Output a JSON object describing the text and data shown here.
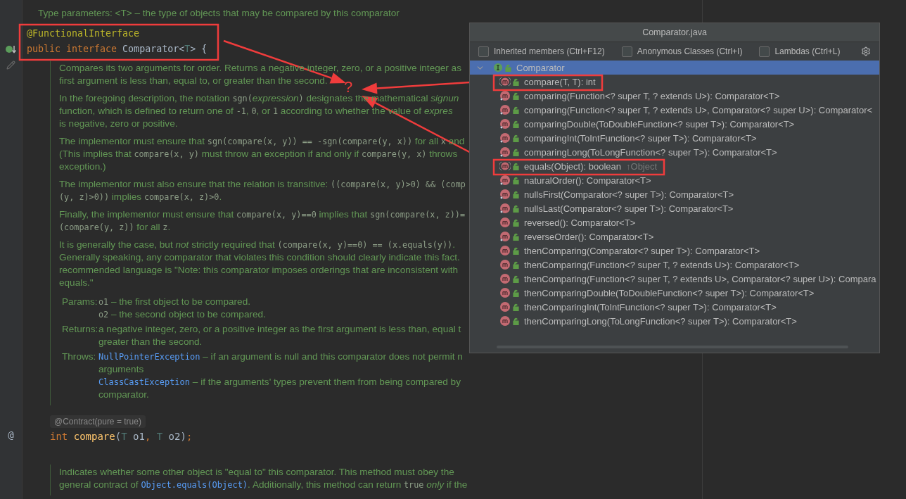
{
  "editor": {
    "type_params": "Type parameters: <T> – the type of objects that may be compared by this comparator",
    "declaration": [
      [
        {
          "kind": "annotation",
          "text": "@FunctionalInterface"
        }
      ],
      [
        {
          "kind": "keyword",
          "text": "public "
        },
        {
          "kind": "keyword",
          "text": "interface "
        },
        {
          "kind": "class",
          "text": "Comparator"
        },
        {
          "kind": "plain",
          "text": "<"
        },
        {
          "kind": "typeparam",
          "text": "T"
        },
        {
          "kind": "plain",
          "text": "> {"
        }
      ]
    ],
    "doc": [
      [
        [
          "Compares its two arguments for order. Returns a negative integer, zero, or a positive integer as"
        ],
        [
          "first argument is less than, equal to, or greater than the second."
        ]
      ],
      [
        [
          "In the foregoing description, the notation ",
          {
            "kind": "code",
            "text": "sgn("
          },
          {
            "kind": "italic",
            "text": "expression"
          },
          {
            "kind": "code",
            "text": ")"
          },
          " designates the mathematical ",
          {
            "kind": "italic",
            "text": "signun"
          }
        ],
        [
          "function, which is defined to return one of ",
          {
            "kind": "code",
            "text": "-1"
          },
          ", ",
          {
            "kind": "code",
            "text": "0"
          },
          ", or ",
          {
            "kind": "code",
            "text": "1"
          },
          " according to whether the value of ",
          {
            "kind": "italic",
            "text": "expres"
          }
        ],
        [
          "is negative, zero or positive."
        ]
      ],
      [
        [
          "The implementor must ensure that ",
          {
            "kind": "code",
            "text": "sgn(compare(x, y)) == -sgn(compare(y, x))"
          },
          " for all ",
          {
            "kind": "code",
            "text": "x"
          },
          " and"
        ],
        [
          "(This implies that ",
          {
            "kind": "code",
            "text": "compare(x, y)"
          },
          " must throw an exception if and only if ",
          {
            "kind": "code",
            "text": "compare(y, x)"
          },
          " throws"
        ],
        [
          "exception.)"
        ]
      ],
      [
        [
          "The implementor must also ensure that the relation is transitive: ",
          {
            "kind": "code",
            "text": "((compare(x, y)>0) && (comp"
          }
        ],
        [
          {
            "kind": "code",
            "text": "(y, z)>0))"
          },
          " implies ",
          {
            "kind": "code",
            "text": "compare(x, z)>0"
          },
          "."
        ]
      ],
      [
        [
          "Finally, the implementor must ensure that ",
          {
            "kind": "code",
            "text": "compare(x, y)==0"
          },
          " implies that ",
          {
            "kind": "code",
            "text": "sgn(compare(x, z))="
          }
        ],
        [
          {
            "kind": "code",
            "text": "(compare(y, z))"
          },
          " for all ",
          {
            "kind": "code",
            "text": "z"
          },
          "."
        ]
      ],
      [
        [
          "It is generally the case, but ",
          {
            "kind": "italic",
            "text": "not"
          },
          " strictly required that ",
          {
            "kind": "code",
            "text": "(compare(x, y)==0) == (x.equals(y))"
          },
          "."
        ],
        [
          "Generally speaking, any comparator that violates this condition should clearly indicate this fact."
        ],
        [
          "recommended language is \"Note: this comparator imposes orderings that are inconsistent with"
        ],
        [
          "equals.\""
        ]
      ]
    ],
    "tags": [
      {
        "label": "Params:",
        "lines": [
          [
            {
              "kind": "code",
              "text": "o1"
            },
            " – the first object to be compared."
          ],
          [
            {
              "kind": "code",
              "text": "o2"
            },
            " – the second object to be compared."
          ]
        ]
      },
      {
        "label": "Returns:",
        "lines": [
          [
            "a negative integer, zero, or a positive integer as the first argument is less than, equal t"
          ],
          [
            "greater than the second."
          ]
        ]
      },
      {
        "label": "Throws:",
        "lines": [
          [
            {
              "kind": "link",
              "text": "NullPointerException"
            },
            " – if an argument is null and this comparator does not permit n"
          ],
          [
            "arguments"
          ],
          [
            {
              "kind": "link",
              "text": "ClassCastException"
            },
            " – if the arguments' types prevent them from being compared by"
          ],
          [
            "comparator."
          ]
        ]
      }
    ],
    "contract": "@Contract(pure = true)",
    "gutter_mark": "@",
    "signature": [
      {
        "kind": "keyword",
        "text": "int "
      },
      {
        "kind": "method",
        "text": "compare"
      },
      {
        "kind": "plain",
        "text": "("
      },
      {
        "kind": "typeparam",
        "text": "T "
      },
      {
        "kind": "plain",
        "text": "o1"
      },
      {
        "kind": "keyword",
        "text": ", "
      },
      {
        "kind": "typeparam",
        "text": "T "
      },
      {
        "kind": "plain",
        "text": "o2"
      },
      {
        "kind": "plain",
        "text": ")"
      },
      {
        "kind": "keyword",
        "text": ";"
      }
    ],
    "doc2": [
      [
        "Indicates whether some other object is \"equal to\" this comparator. This method must obey the"
      ],
      [
        "general contract of ",
        {
          "kind": "link",
          "text": "Object.equals(Object)"
        },
        ". Additionally, this method can return ",
        {
          "kind": "code",
          "text": "true"
        },
        {
          "kind": "italic",
          "text": " only"
        },
        " if the"
      ]
    ]
  },
  "popup": {
    "title": "Comparator.java",
    "options": [
      {
        "label": "Inherited members (Ctrl+F12)",
        "checked": false
      },
      {
        "label": "Anonymous Classes (Ctrl+I)",
        "checked": false
      },
      {
        "label": "Lambdas (Ctrl+L)",
        "checked": false
      }
    ],
    "tree": {
      "label": "Comparator",
      "expanded": true,
      "selected": true,
      "children": [
        {
          "label": "compare(T, T): int",
          "kind": "abstract",
          "selected": false
        },
        {
          "label": "comparing(Function<? super T, ? extends U>): Comparator<T>",
          "kind": "static",
          "selected": false
        },
        {
          "label": "comparing(Function<? super T, ? extends U>, Comparator<? super U>): Comparator<",
          "kind": "static",
          "selected": false
        },
        {
          "label": "comparingDouble(ToDoubleFunction<? super T>): Comparator<T>",
          "kind": "static",
          "selected": false
        },
        {
          "label": "comparingInt(ToIntFunction<? super T>): Comparator<T>",
          "kind": "static",
          "selected": false
        },
        {
          "label": "comparingLong(ToLongFunction<? super T>): Comparator<T>",
          "kind": "static",
          "selected": false
        },
        {
          "label": "equals(Object): boolean",
          "suffix": "↑Object",
          "kind": "abstract",
          "selected": false
        },
        {
          "label": "naturalOrder(): Comparator<T>",
          "kind": "static",
          "selected": false
        },
        {
          "label": "nullsFirst(Comparator<? super T>): Comparator<T>",
          "kind": "static",
          "selected": false
        },
        {
          "label": "nullsLast(Comparator<? super T>): Comparator<T>",
          "kind": "static",
          "selected": false
        },
        {
          "label": "reversed(): Comparator<T>",
          "kind": "instance",
          "selected": false
        },
        {
          "label": "reverseOrder(): Comparator<T>",
          "kind": "static",
          "selected": false
        },
        {
          "label": "thenComparing(Comparator<? super T>): Comparator<T>",
          "kind": "instance",
          "selected": false
        },
        {
          "label": "thenComparing(Function<? super T, ? extends U>): Comparator<T>",
          "kind": "instance",
          "selected": false
        },
        {
          "label": "thenComparing(Function<? super T, ? extends U>, Comparator<? super U>): Compara",
          "kind": "instance",
          "selected": false
        },
        {
          "label": "thenComparingDouble(ToDoubleFunction<? super T>): Comparator<T>",
          "kind": "instance",
          "selected": false
        },
        {
          "label": "thenComparingInt(ToIntFunction<? super T>): Comparator<T>",
          "kind": "instance",
          "selected": false
        },
        {
          "label": "thenComparingLong(ToLongFunction<? super T>): Comparator<T>",
          "kind": "instance",
          "selected": false
        }
      ]
    }
  },
  "annotation": {
    "mark": "?"
  }
}
